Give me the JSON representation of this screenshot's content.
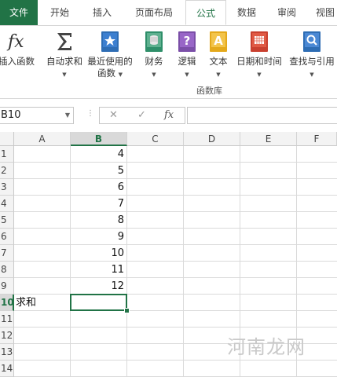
{
  "ribbon_tabs": [
    {
      "label": "文件"
    },
    {
      "label": "开始"
    },
    {
      "label": "插入"
    },
    {
      "label": "页面布局"
    },
    {
      "label": "公式"
    },
    {
      "label": "数据"
    },
    {
      "label": "审阅"
    },
    {
      "label": "视图"
    }
  ],
  "ribbon": {
    "buttons": [
      {
        "label": "插入函数",
        "icon": "fx-icon"
      },
      {
        "label": "自动求和",
        "icon": "sigma-icon"
      },
      {
        "label": "最近使用的",
        "label2": "函数",
        "icon": "star-book-icon"
      },
      {
        "label": "财务",
        "icon": "finance-book-icon"
      },
      {
        "label": "逻辑",
        "icon": "logic-book-icon"
      },
      {
        "label": "文本",
        "icon": "text-book-icon"
      },
      {
        "label": "日期和时间",
        "icon": "calendar-book-icon"
      },
      {
        "label": "查找与引用",
        "icon": "lookup-book-icon"
      }
    ],
    "group_label": "函数库"
  },
  "formula_bar": {
    "name_box": "B10",
    "fx_label": "fx",
    "cancel_symbol": "✕",
    "enter_symbol": "✓",
    "value": ""
  },
  "columns": [
    "A",
    "B",
    "C",
    "D",
    "E",
    "F"
  ],
  "selected_column": "B",
  "rows": [
    {
      "header": "1",
      "a": "",
      "b": "4"
    },
    {
      "header": "2",
      "a": "",
      "b": "5"
    },
    {
      "header": "3",
      "a": "",
      "b": "6"
    },
    {
      "header": "4",
      "a": "",
      "b": "7"
    },
    {
      "header": "5",
      "a": "",
      "b": "8"
    },
    {
      "header": "6",
      "a": "",
      "b": "9"
    },
    {
      "header": "7",
      "a": "",
      "b": "10"
    },
    {
      "header": "8",
      "a": "",
      "b": "11"
    },
    {
      "header": "9",
      "a": "",
      "b": "12"
    },
    {
      "header": "10",
      "a": "求和",
      "b": ""
    },
    {
      "header": "11",
      "a": "",
      "b": ""
    },
    {
      "header": "12",
      "a": "",
      "b": ""
    },
    {
      "header": "13",
      "a": "",
      "b": ""
    },
    {
      "header": "14",
      "a": "",
      "b": ""
    }
  ],
  "selected_row": "10",
  "watermark": "河南龙网",
  "colors": {
    "accent": "#217346"
  }
}
